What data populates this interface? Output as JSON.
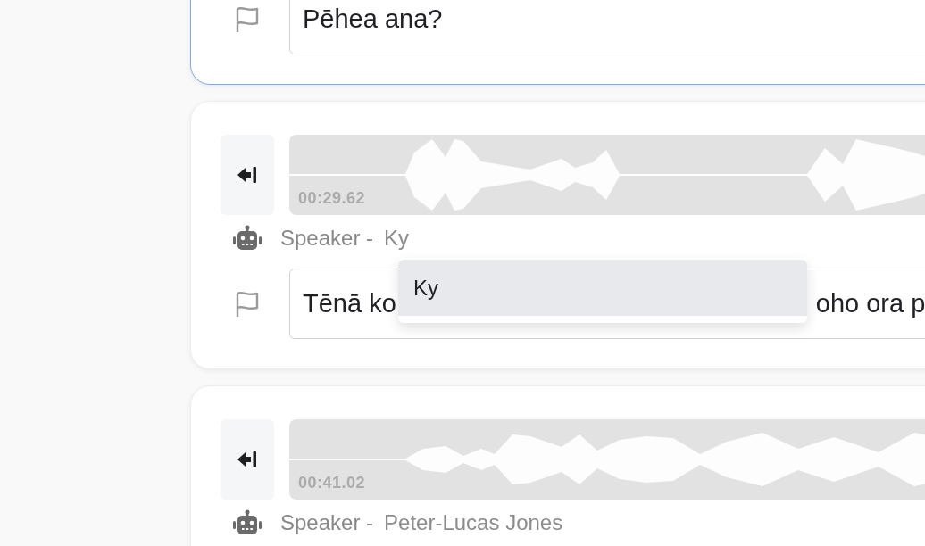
{
  "segments": [
    {
      "focused": true,
      "transcript": {
        "parts": [
          "Pēhea ana?"
        ]
      }
    },
    {
      "focused": false,
      "time": "00:29.62",
      "speaker_label": "Speaker -",
      "speaker": "Ky",
      "transcript": {
        "parts": [
          "Tēnā ko",
          "oho ora p"
        ]
      },
      "dropdown": {
        "options": [
          {
            "label": "Ky",
            "selected": true
          }
        ]
      }
    },
    {
      "focused": false,
      "time": "00:41.02",
      "speaker_label": "Speaker -",
      "speaker": "Peter-Lucas Jones"
    }
  ]
}
